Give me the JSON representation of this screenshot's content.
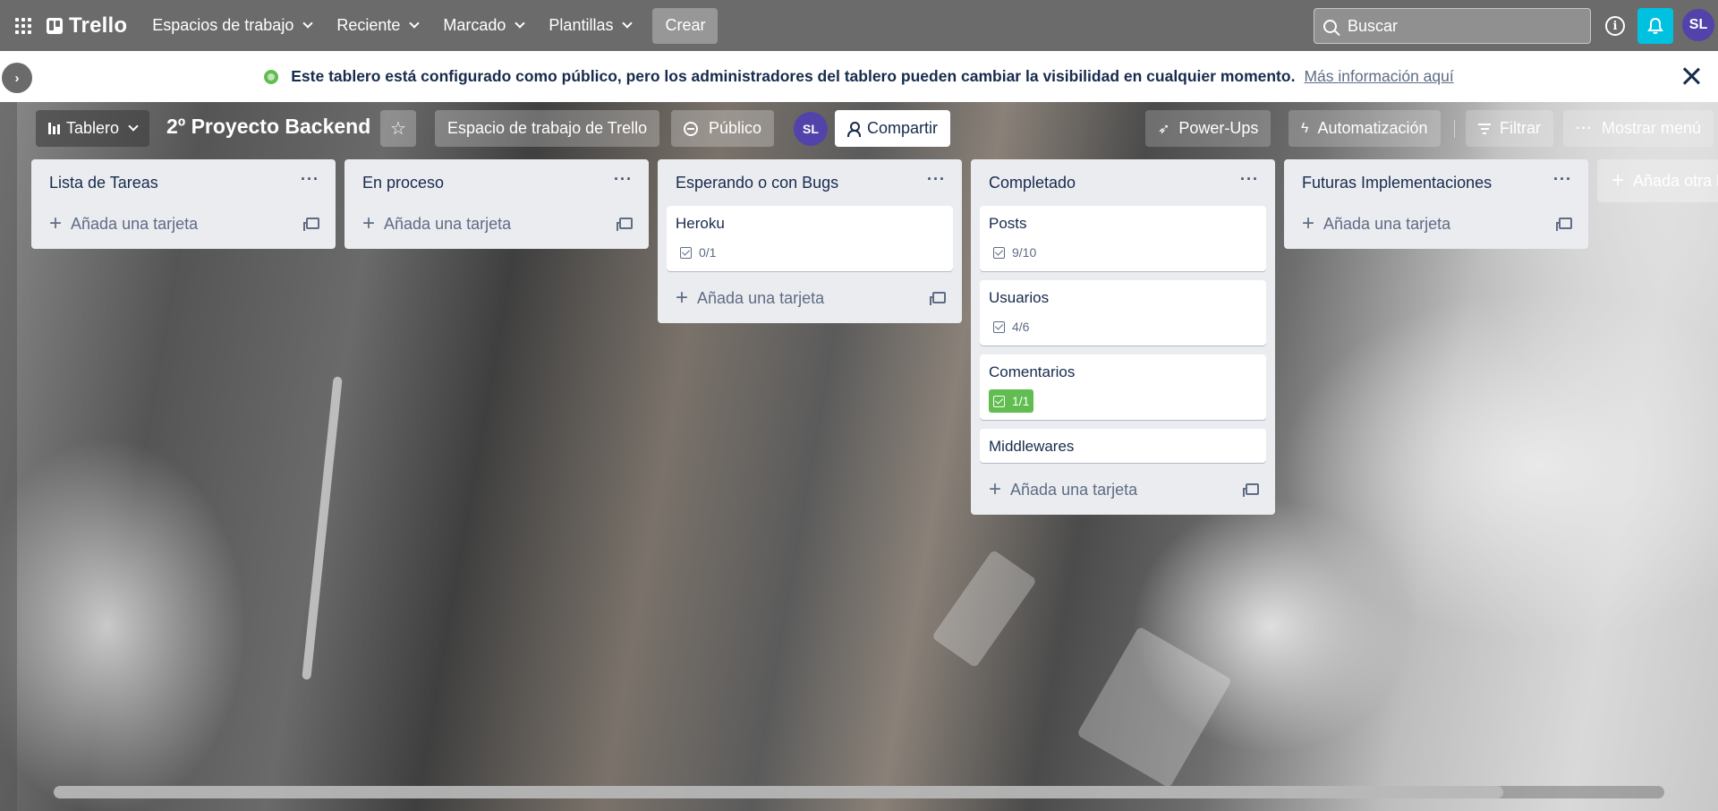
{
  "nav": {
    "logo": "Trello",
    "menus": [
      "Espacios de trabajo",
      "Reciente",
      "Marcado",
      "Plantillas"
    ],
    "create": "Crear",
    "search_placeholder": "Buscar",
    "user_initials": "SL"
  },
  "banner": {
    "text": "Este tablero está configurado como público, pero los administradores del tablero pueden cambiar la visibilidad en cualquier momento.",
    "link": "Más información aquí"
  },
  "board": {
    "view": "Tablero",
    "title": "2º Proyecto Backend",
    "workspace": "Espacio de trabajo de Trello",
    "visibility": "Público",
    "member_initials": "SL",
    "share": "Compartir",
    "powerups": "Power-Ups",
    "automation": "Automatización",
    "filter": "Filtrar",
    "menu": "Mostrar menú",
    "add_list": "Añada otra lista"
  },
  "add_card_label": "Añada una tarjeta",
  "lists": [
    {
      "title": "Lista de Tareas",
      "cards": []
    },
    {
      "title": "En proceso",
      "cards": []
    },
    {
      "title": "Esperando o con Bugs",
      "cards": [
        {
          "title": "Heroku",
          "checklist": "0/1",
          "complete": false
        }
      ]
    },
    {
      "title": "Completado",
      "cards": [
        {
          "title": "Posts",
          "checklist": "9/10",
          "complete": false
        },
        {
          "title": "Usuarios",
          "checklist": "4/6",
          "complete": false
        },
        {
          "title": "Comentarios",
          "checklist": "1/1",
          "complete": true
        },
        {
          "title": "Middlewares"
        }
      ]
    },
    {
      "title": "Futuras Implementaciones",
      "cards": []
    }
  ],
  "colors": {
    "nav_bg": "#6b6b6b",
    "notification": "#00c2e0",
    "avatar": "#5243aa",
    "checklist_done": "#61bd4f",
    "list_bg": "#ebecf0"
  },
  "scroll_fraction": 0.9
}
